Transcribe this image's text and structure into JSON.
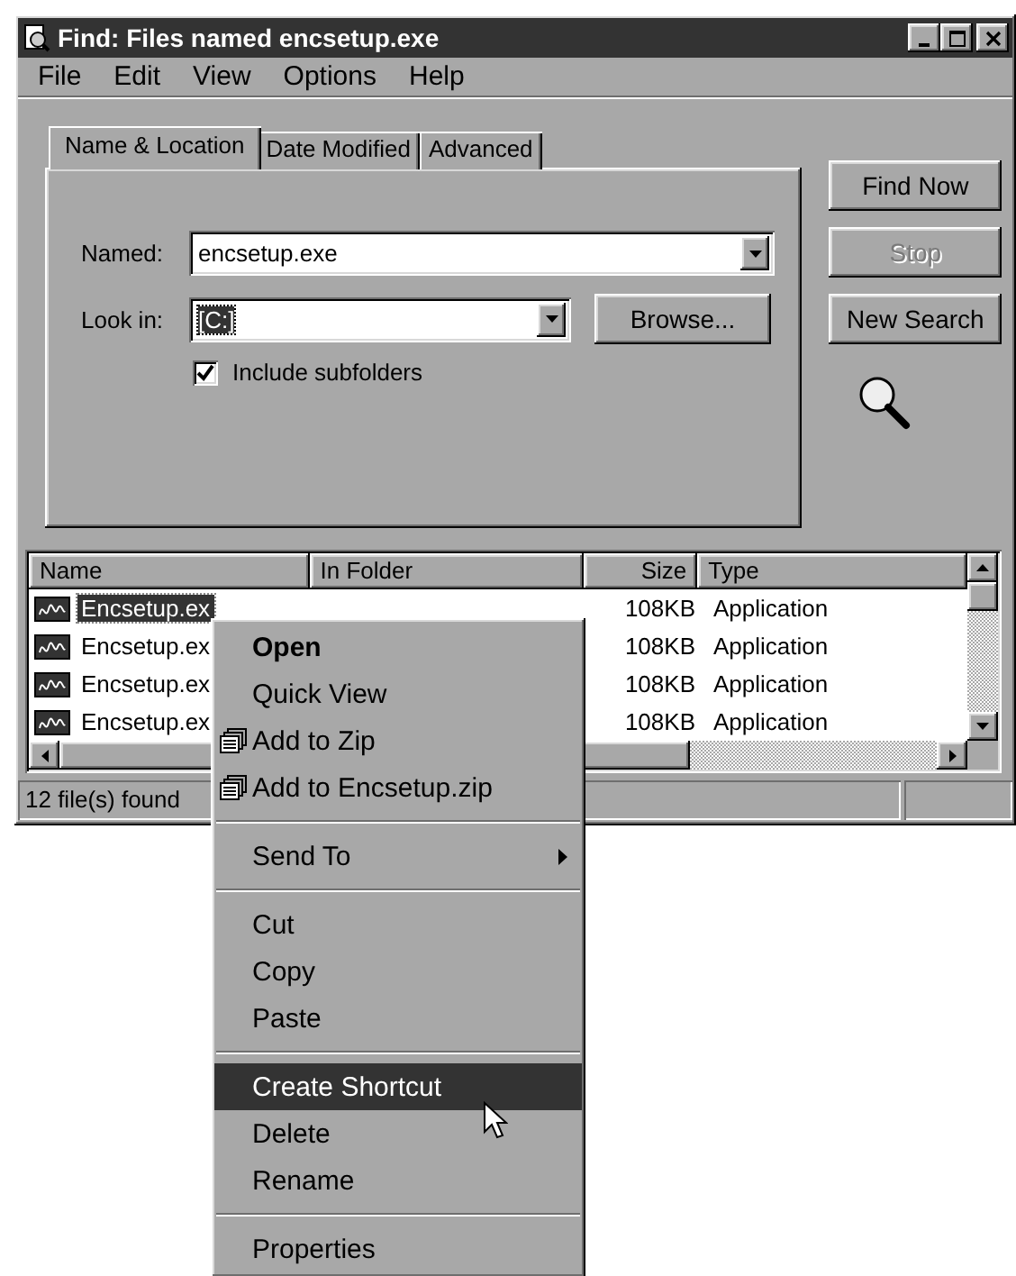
{
  "window": {
    "title": "Find: Files named encsetup.exe",
    "menu": [
      "File",
      "Edit",
      "View",
      "Options",
      "Help"
    ],
    "tabs": [
      {
        "label": "Name & Location",
        "selected": true
      },
      {
        "label": "Date Modified",
        "selected": false
      },
      {
        "label": "Advanced",
        "selected": false
      }
    ],
    "named": {
      "label": "Named:",
      "value": "encsetup.exe"
    },
    "look_in": {
      "label": "Look in:",
      "value": "[C:]",
      "value_selected": true
    },
    "browse_button": "Browse...",
    "include_subfolders": {
      "label": "Include subfolders",
      "checked": true
    },
    "buttons": [
      {
        "label": "Find Now",
        "disabled": false
      },
      {
        "label": "Stop",
        "disabled": true
      },
      {
        "label": "New Search",
        "disabled": false
      }
    ],
    "list": {
      "columns": [
        "Name",
        "In Folder",
        "Size",
        "Type"
      ],
      "rows": [
        {
          "name": "Encsetup.ex",
          "size": "108KB",
          "type": "Application",
          "selected": true
        },
        {
          "name": "Encsetup.ex",
          "size": "108KB",
          "type": "Application",
          "selected": false
        },
        {
          "name": "Encsetup.ex",
          "size": "108KB",
          "type": "Application",
          "selected": false
        },
        {
          "name": "Encsetup.ex",
          "size": "108KB",
          "type": "Application",
          "selected": false
        }
      ]
    },
    "status_bar": [
      "12 file(s) found"
    ]
  },
  "context_menu": {
    "items": [
      {
        "kind": "item",
        "label": "Open",
        "default": true,
        "selected": false
      },
      {
        "kind": "item",
        "label": "Quick View",
        "default": false,
        "selected": false
      },
      {
        "kind": "icon-item",
        "label": "Add to Zip",
        "default": false,
        "selected": false
      },
      {
        "kind": "icon-item",
        "label": "Add to Encsetup.zip",
        "default": false,
        "selected": false
      },
      {
        "kind": "separator"
      },
      {
        "kind": "submenu",
        "label": "Send To",
        "default": false,
        "selected": false
      },
      {
        "kind": "separator"
      },
      {
        "kind": "item",
        "label": "Cut",
        "default": false,
        "selected": false
      },
      {
        "kind": "item",
        "label": "Copy",
        "default": false,
        "selected": false
      },
      {
        "kind": "item",
        "label": "Paste",
        "default": false,
        "selected": false
      },
      {
        "kind": "separator"
      },
      {
        "kind": "item",
        "label": "Create Shortcut",
        "default": false,
        "selected": true
      },
      {
        "kind": "item",
        "label": "Delete",
        "default": false,
        "selected": false
      },
      {
        "kind": "item",
        "label": "Rename",
        "default": false,
        "selected": false
      },
      {
        "kind": "separator"
      },
      {
        "kind": "item",
        "label": "Properties",
        "default": false,
        "selected": false
      }
    ]
  }
}
